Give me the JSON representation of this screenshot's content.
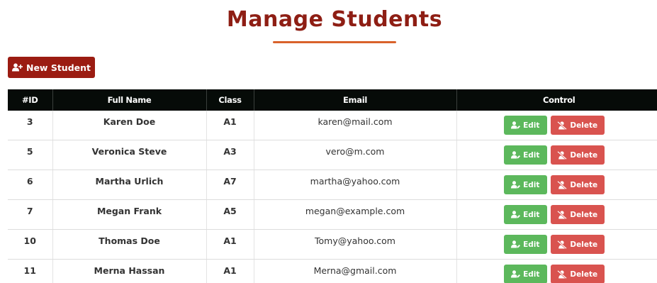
{
  "page": {
    "title": "Manage Students"
  },
  "toolbar": {
    "new_student_label": "New Student",
    "new_student_icon": "user-plus-icon"
  },
  "table": {
    "columns": [
      "#ID",
      "Full Name",
      "Class",
      "Email",
      "Control"
    ],
    "edit_label": "Edit",
    "delete_label": "Delete",
    "edit_icon": "user-edit-icon",
    "delete_icon": "user-slash-icon",
    "rows": [
      {
        "id": "3",
        "name": "Karen Doe",
        "class": "A1",
        "email": "karen@mail.com"
      },
      {
        "id": "5",
        "name": "Veronica Steve",
        "class": "A3",
        "email": "vero@m.com"
      },
      {
        "id": "6",
        "name": "Martha Urlich",
        "class": "A7",
        "email": "martha@yahoo.com"
      },
      {
        "id": "7",
        "name": "Megan Frank",
        "class": "A5",
        "email": "megan@example.com"
      },
      {
        "id": "10",
        "name": "Thomas Doe",
        "class": "A1",
        "email": "Tomy@yahoo.com"
      },
      {
        "id": "11",
        "name": "Merna Hassan",
        "class": "A1",
        "email": "Merna@gmail.com"
      }
    ]
  },
  "colors": {
    "title": "#8e1e14",
    "underline": "#d9622b",
    "primary_button": "#9b1c12",
    "header_bg": "#060b08",
    "edit_button": "#5cb85c",
    "delete_button": "#d9534f"
  }
}
